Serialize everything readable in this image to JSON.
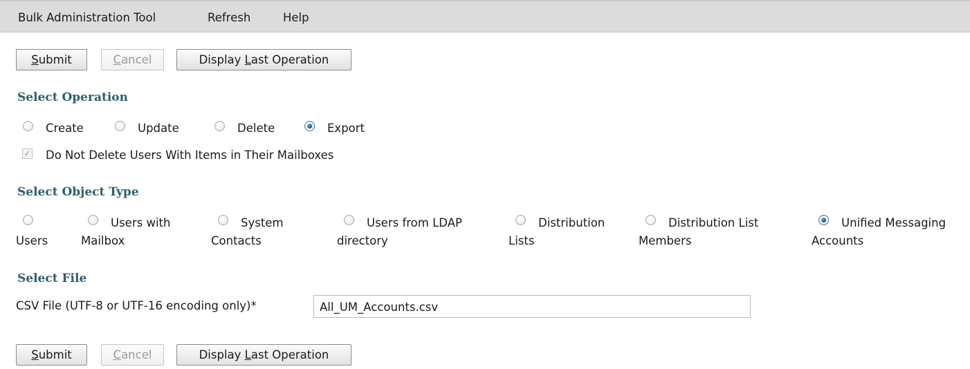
{
  "menubar": {
    "items": [
      "Bulk Administration Tool",
      "Refresh",
      "Help"
    ]
  },
  "toolbar_top": {
    "submit": {
      "pre": "",
      "acc": "S",
      "post": "ubmit"
    },
    "cancel": {
      "pre": "",
      "acc": "C",
      "post": "ancel"
    },
    "display_last": {
      "pre": "Display ",
      "acc": "L",
      "post": "ast Operation"
    }
  },
  "select_operation": {
    "title": "Select Operation",
    "options": [
      {
        "label": "Create",
        "checked": false
      },
      {
        "label": "Update",
        "checked": false
      },
      {
        "label": "Delete",
        "checked": false
      },
      {
        "label": "Export",
        "checked": true
      }
    ],
    "do_not_delete": {
      "label": "Do Not Delete Users With Items in Their Mailboxes",
      "checked": true,
      "disabled": true
    }
  },
  "select_object_type": {
    "title": "Select Object Type",
    "options": [
      {
        "line1": "",
        "line2": "Users",
        "checked": false
      },
      {
        "line1": "Users with",
        "line2": "Mailbox",
        "checked": false
      },
      {
        "line1": "System",
        "line2": "Contacts",
        "checked": false
      },
      {
        "line1": "Users from LDAP",
        "line2": "directory",
        "checked": false
      },
      {
        "line1": "Distribution",
        "line2": "Lists",
        "checked": false
      },
      {
        "line1": "Distribution List",
        "line2": "Members",
        "checked": false
      },
      {
        "line1": "Unified Messaging",
        "line2": "Accounts",
        "checked": true
      }
    ]
  },
  "select_file": {
    "title": "Select File",
    "label": "CSV File (UTF-8 or UTF-16 encoding only)*",
    "value": "All_UM_Accounts.csv"
  },
  "toolbar_bottom": {
    "submit": {
      "pre": "",
      "acc": "S",
      "post": "ubmit"
    },
    "cancel": {
      "pre": "",
      "acc": "C",
      "post": "ancel"
    },
    "display_last": {
      "pre": "Display ",
      "acc": "L",
      "post": "ast Operation"
    }
  }
}
